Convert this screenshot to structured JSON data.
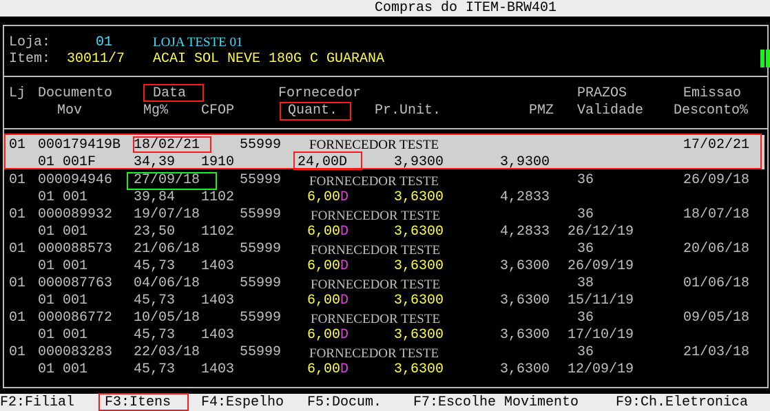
{
  "window": {
    "title": "Compras do ITEM-BRW401"
  },
  "info": {
    "loja_label": "Loja:",
    "loja_code": "01",
    "loja_name": "LOJA TESTE 01",
    "item_label": "Item:",
    "item_code": "30011/7",
    "item_desc": "ACAI SOL NEVE 180G C GUARANA"
  },
  "headers": {
    "lj": "Lj",
    "documento": "Documento",
    "data": "Data",
    "fornecedor": "Fornecedor",
    "prazos": "PRAZOS",
    "emissao": "Emissao",
    "mov": "Mov",
    "mg": "Mg%",
    "cfop": "CFOP",
    "quant": "Quant.",
    "prunit": "Pr.Unit.",
    "pmz": "PMZ",
    "validade": "Validade",
    "desconto": "Desconto%"
  },
  "rows": [
    {
      "lj": "01",
      "doc": "000179419B",
      "data": "18/02/21",
      "forn_cod": "55999",
      "forn_nome": "FORNECEDOR TESTE",
      "prazo": "",
      "emissao": "17/02/21",
      "mov": "01 001F",
      "mg": "34,39",
      "cfop": "1910",
      "quant": "24,00",
      "quant_flag": "D",
      "prunit": "3,9300",
      "pmz": "3,9300",
      "validade": ""
    },
    {
      "lj": "01",
      "doc": "000094946",
      "data": "27/09/18",
      "forn_cod": "55999",
      "forn_nome": "FORNECEDOR TESTE",
      "prazo": "36",
      "emissao": "26/09/18",
      "mov": "01 001",
      "mg": "39,84",
      "cfop": "1102",
      "quant": "6,00",
      "quant_flag": "D",
      "prunit": "3,6300",
      "pmz": "4,2833",
      "validade": ""
    },
    {
      "lj": "01",
      "doc": "000089932",
      "data": "19/07/18",
      "forn_cod": "55999",
      "forn_nome": "FORNECEDOR TESTE",
      "prazo": "36",
      "emissao": "18/07/18",
      "mov": "01 001",
      "mg": "23,50",
      "cfop": "1102",
      "quant": "6,00",
      "quant_flag": "D",
      "prunit": "3,6300",
      "pmz": "4,2833",
      "validade": "26/12/19"
    },
    {
      "lj": "01",
      "doc": "000088573",
      "data": "21/06/18",
      "forn_cod": "55999",
      "forn_nome": "FORNECEDOR TESTE",
      "prazo": "36",
      "emissao": "20/06/18",
      "mov": "01 001",
      "mg": "45,73",
      "cfop": "1403",
      "quant": "6,00",
      "quant_flag": "D",
      "prunit": "3,6300",
      "pmz": "3,6300",
      "validade": "26/09/19"
    },
    {
      "lj": "01",
      "doc": "000087763",
      "data": "04/06/18",
      "forn_cod": "55999",
      "forn_nome": "FORNECEDOR TESTE",
      "prazo": "38",
      "emissao": "01/06/18",
      "mov": "01 001",
      "mg": "45,73",
      "cfop": "1403",
      "quant": "6,00",
      "quant_flag": "D",
      "prunit": "3,6300",
      "pmz": "3,6300",
      "validade": "15/11/19"
    },
    {
      "lj": "01",
      "doc": "000086772",
      "data": "10/05/18",
      "forn_cod": "55999",
      "forn_nome": "FORNECEDOR TESTE",
      "prazo": "36",
      "emissao": "09/05/18",
      "mov": "01 001",
      "mg": "45,73",
      "cfop": "1403",
      "quant": "6,00",
      "quant_flag": "D",
      "prunit": "3,6300",
      "pmz": "3,6300",
      "validade": "17/10/19"
    },
    {
      "lj": "01",
      "doc": "000083283",
      "data": "22/03/18",
      "forn_cod": "55999",
      "forn_nome": "FORNECEDOR TESTE",
      "prazo": "36",
      "emissao": "21/03/18",
      "mov": "01 001",
      "mg": "45,73",
      "cfop": "1403",
      "quant": "6,00",
      "quant_flag": "D",
      "prunit": "3,6300",
      "pmz": "3,6300",
      "validade": "12/09/19"
    }
  ],
  "footer": {
    "f2": "F2:Filial",
    "f3": "F3:Itens",
    "f4": "F4:Espelho",
    "f5": "F5:Docum.",
    "f7": "F7:Escolhe Movimento",
    "f9": "F9:Ch.Eletronica"
  },
  "colors": {
    "background": "#000000",
    "text": "#c0c0c0",
    "highlight_row": "#d0d0d0",
    "value_yellow": "#ffff40",
    "value_cyan": "#40e0ff",
    "flag_magenta": "#e040e0",
    "annotation_red": "#ff1a1a",
    "annotation_green": "#20ee20"
  }
}
